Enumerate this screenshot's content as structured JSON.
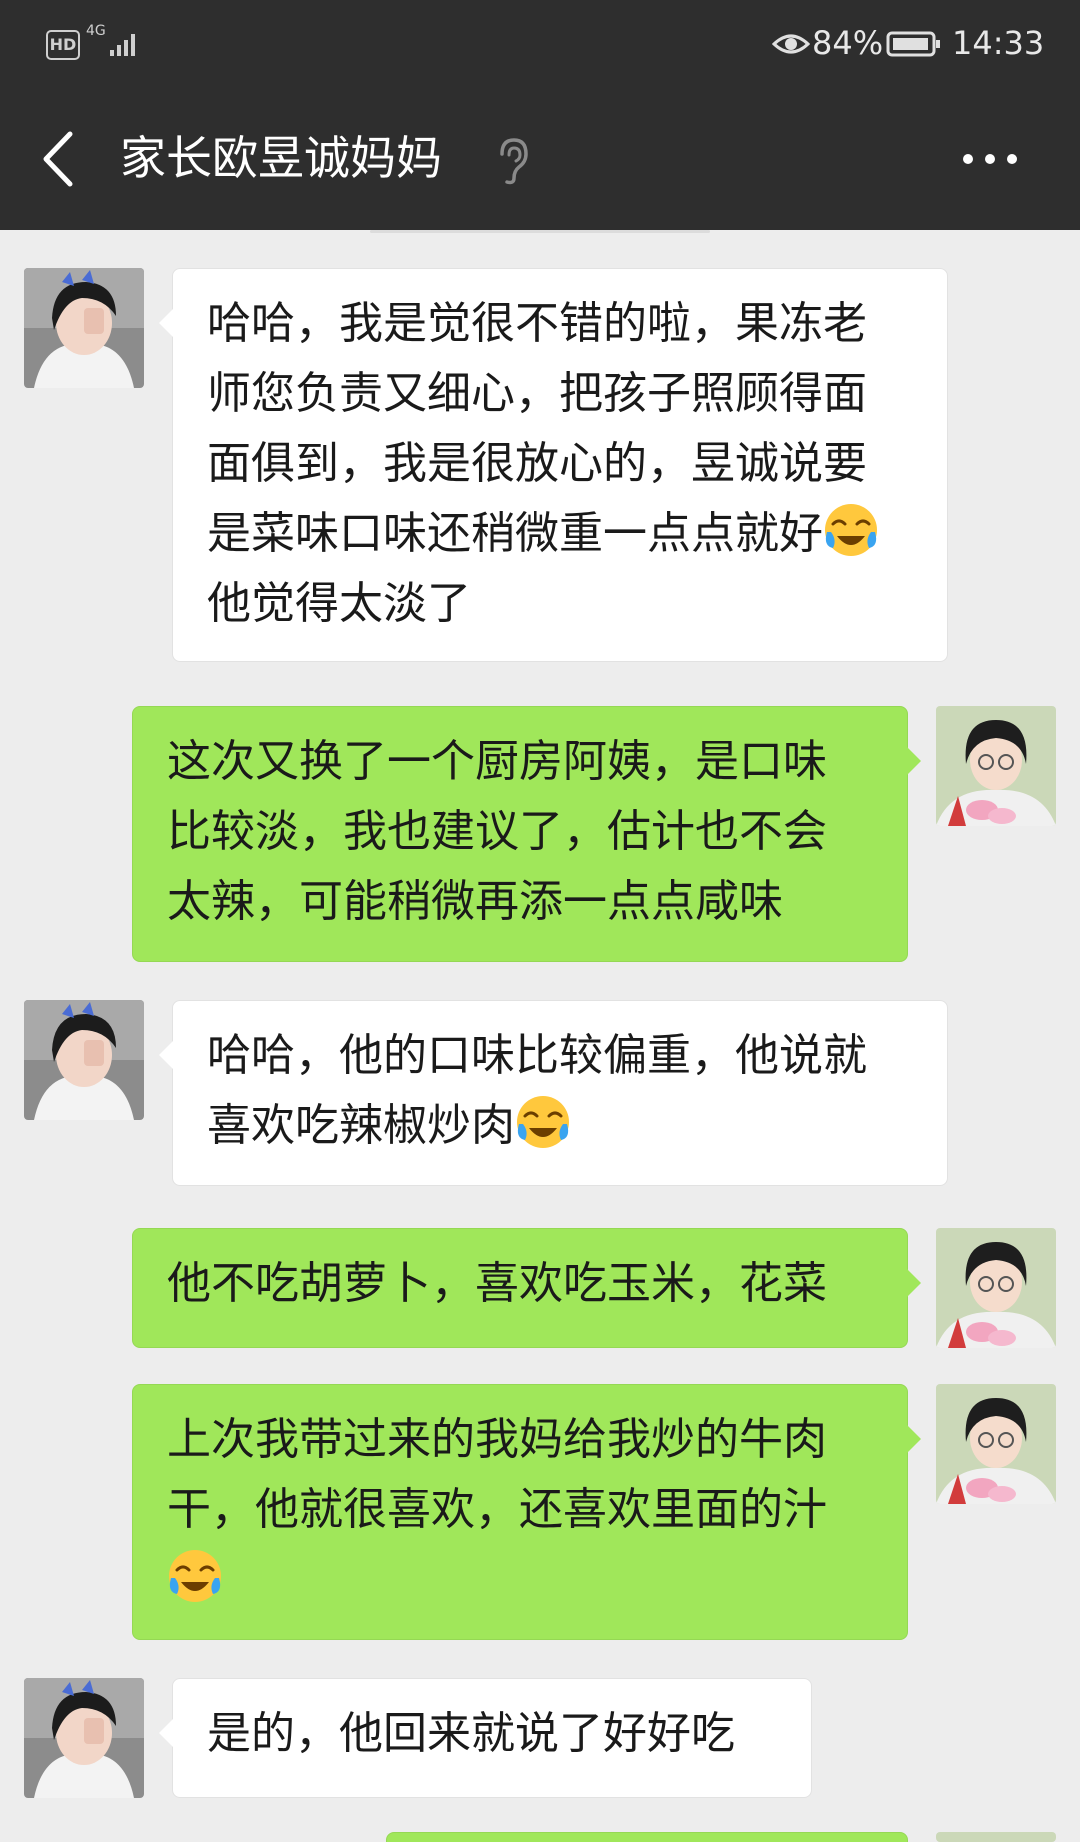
{
  "status_bar": {
    "hd_label": "HD",
    "network_label": "4G",
    "battery_percent": "84%",
    "time": "14:33",
    "icons": [
      "hd-icon",
      "signal-icon",
      "eye-icon",
      "battery-icon"
    ]
  },
  "title_bar": {
    "title": "家长欧昱诚妈妈",
    "icons": [
      "back-icon",
      "ear-icon",
      "more-icon"
    ]
  },
  "colors": {
    "header_bg": "#2e2e2e",
    "chat_bg": "#ededed",
    "sent_bubble": "#a0e75a",
    "received_bubble": "#ffffff"
  },
  "messages": [
    {
      "side": "received",
      "lines": [
        "哈哈，我是觉很不错的啦，果冻老",
        "师您负责又细心，把孩子照顾得面",
        "面俱到，我是很放心的，昱诚说要",
        "是菜味口味还稍微重一点点就好",
        "他觉得太淡了"
      ],
      "emoji": "face-with-tears-emoji"
    },
    {
      "side": "sent",
      "lines": [
        "这次又换了一个厨房阿姨，是口味",
        "比较淡，我也建议了，估计也不会",
        "太辣，可能稍微再添一点点咸味"
      ]
    },
    {
      "side": "received",
      "lines": [
        "哈哈，他的口味比较偏重，他说就",
        "喜欢吃辣椒炒肉"
      ],
      "emoji": "face-with-tears-emoji"
    },
    {
      "side": "sent",
      "lines": [
        "他不吃胡萝卜，喜欢吃玉米，花菜"
      ]
    },
    {
      "side": "sent",
      "lines": [
        "上次我带过来的我妈给我炒的牛肉",
        "干，他就很喜欢，还喜欢里面的汁"
      ],
      "emoji": "face-with-tears-emoji"
    },
    {
      "side": "received",
      "lines": [
        "是的，他回来就说了好好吃"
      ]
    }
  ]
}
